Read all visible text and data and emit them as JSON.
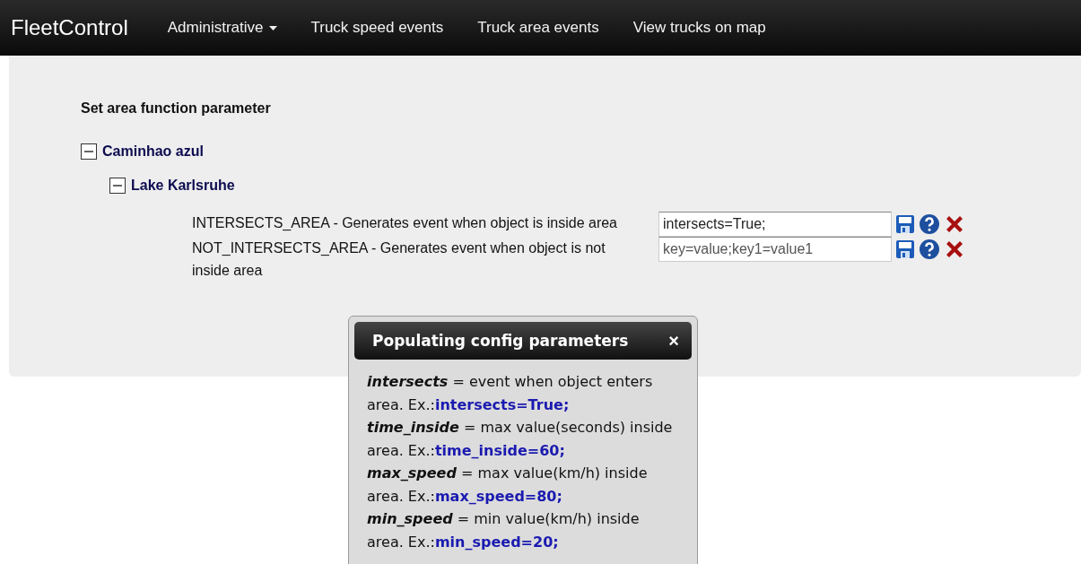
{
  "navbar": {
    "brand": "FleetControl",
    "items": [
      {
        "label": "Administrative",
        "kind": "dropdown"
      },
      {
        "label": "Truck speed events",
        "kind": "link"
      },
      {
        "label": "Truck area events",
        "kind": "link"
      },
      {
        "label": "View trucks on map",
        "kind": "link"
      }
    ]
  },
  "panel": {
    "title": "Set area function parameter",
    "tree": [
      {
        "label": "Caminhao azul",
        "expanded": true,
        "children": [
          {
            "label": "Lake Karlsruhe",
            "expanded": true,
            "functions": [
              {
                "description": "INTERSECTS_AREA - Generates event when object is inside area",
                "value": "intersects=True;"
              },
              {
                "description": "NOT_INTERSECTS_AREA - Generates event when object is not inside area",
                "placeholder": "key=value;key1=value1"
              }
            ]
          }
        ]
      }
    ]
  },
  "popup": {
    "title": "Populating config parameters",
    "close": "×",
    "params": [
      {
        "term": "intersects",
        "description": " = event when object enters area. Ex.:",
        "example": "intersects=True;"
      },
      {
        "term": "time_inside",
        "description": " = max value(seconds) inside area. Ex.:",
        "example": "time_inside=60;"
      },
      {
        "term": "max_speed",
        "description": " = max value(km/h) inside area. Ex.:",
        "example": "max_speed=80;"
      },
      {
        "term": "min_speed",
        "description": " = min value(km/h) inside area. Ex.:",
        "example": "min_speed=20;"
      }
    ]
  }
}
